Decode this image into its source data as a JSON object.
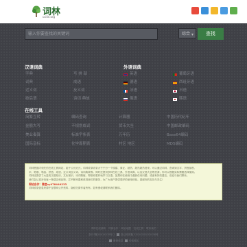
{
  "header": {
    "logo_title": "词林",
    "logo_subtitle": "ccilin.org",
    "share_icons": [
      {
        "name": "weibo-icon",
        "color": "#e84b3c"
      },
      {
        "name": "tencent-weibo-icon",
        "color": "#3a8fd9"
      },
      {
        "name": "qzone-icon",
        "color": "#f2b72b"
      },
      {
        "name": "kaixin-icon",
        "color": "#4a9be0"
      },
      {
        "name": "add-share-icon",
        "color": "#5fae4d"
      }
    ]
  },
  "search": {
    "placeholder": "输入你要查找的关键词",
    "select_value": "综合",
    "button_label": "查找"
  },
  "hanyu": {
    "title": "汉语词典",
    "links": [
      [
        "字典",
        "写 拼 部"
      ],
      [
        "词典",
        "成语"
      ],
      [
        "近义词",
        "反义词"
      ],
      [
        "歇后语",
        "诗词 典故"
      ]
    ]
  },
  "waiyu": {
    "title": "外语词典",
    "langs": [
      [
        "英语",
        "葡萄牙语"
      ],
      [
        "德语",
        "西班牙语"
      ],
      [
        "法语",
        "日语"
      ],
      [
        "俄语",
        "韩语"
      ]
    ]
  },
  "tools": {
    "title": "在线工具",
    "rows": [
      [
        "简繁互转",
        "编码查询",
        "计算器",
        "中国历代纪年"
      ],
      [
        "金额大写",
        "不规划成词",
        "货币大全",
        "中国邮政编码"
      ],
      [
        "美业奏算",
        "标准宇条表",
        "万年历",
        "Base64编码"
      ],
      [
        "国际音标",
        "化学周期表",
        "村区 地区",
        "MD5编码"
      ]
    ]
  },
  "notice": {
    "lines": [
      "词林是国内领先的在线工具网站，始于公元纪元，词林收录收录大于于分一个楼建、象征、超热，超热超热语来。可以通过词林，查询到汉字、拼音部首、",
      "字、笔顺、笔画、拼音、成语、近义词反义词、诗词典故等。同时还提供多种在线工具、外语词典、以及汉语大全等资源，你可以根据实际需要选择使用。",
      "词林还提供了大量的汉语知识、文化常识、诗词歌赋，帮助你更好地学习汉语。如果你在使用中遇到任何问题，或者有好的建议，欢迎与我们联系。",
      "我们会认真对待每一条建议和反馈，并不断完善和改进我们的服务，为广大用户提供更好的使用体验。感谢你的支持与关注！",
      "词林收录信息来源于互联网公开资料，版权归原作者所有。如有侵权请联系我们删除。"
    ],
    "wechat": "网站合作：微信xy978444233"
  },
  "footer": {
    "links": [
      "词林在线辞典",
      "词典合作",
      "网站地图",
      "在线工具",
      "联系我们"
    ],
    "icp": "浙ICP备18014576号-1",
    "police": "浙公网安备 33010202001036号",
    "badges": [
      "备案信息",
      "可信网站"
    ]
  }
}
